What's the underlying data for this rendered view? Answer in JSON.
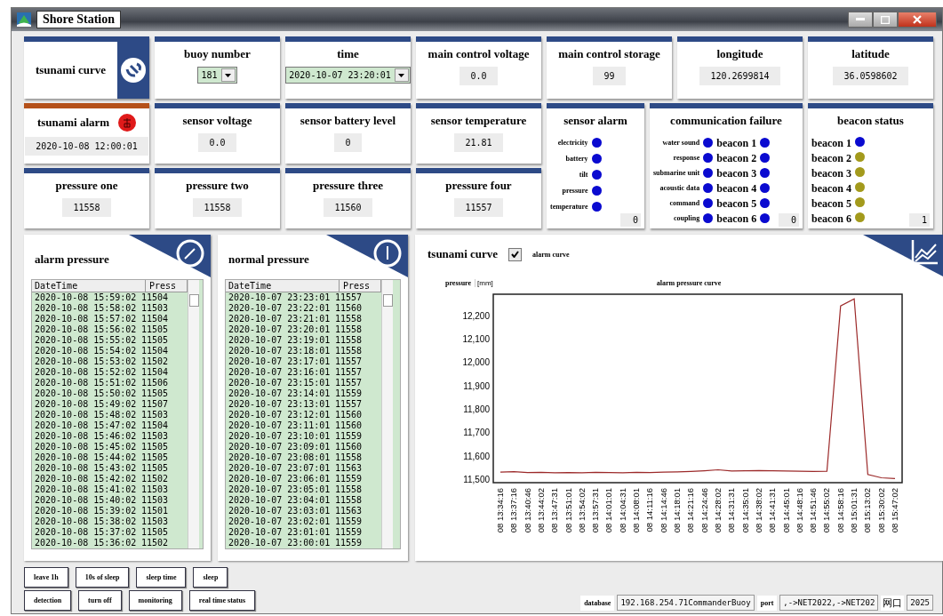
{
  "window": {
    "title": "Shore Station"
  },
  "header_card": {
    "label": "tsunami curve"
  },
  "info_cards": [
    {
      "kind": "select",
      "label": "buoy number",
      "value": "181"
    },
    {
      "kind": "select",
      "label": "time",
      "value": "2020-10-07 23:20:01"
    },
    {
      "kind": "readout",
      "label": "main control voltage",
      "value": "0.0"
    },
    {
      "kind": "readout",
      "label": "main control storage",
      "value": "99"
    },
    {
      "kind": "readout",
      "label": "longitude",
      "value": "120.2699814"
    },
    {
      "kind": "readout",
      "label": "latitude",
      "value": "36.0598602"
    }
  ],
  "tsunami_alarm": {
    "label": "tsunami alarm",
    "active": true,
    "value": "2020-10-08 12:00:01"
  },
  "sensor_cards": [
    {
      "label": "sensor voltage",
      "value": "0.0"
    },
    {
      "label": "sensor battery level",
      "value": "0"
    },
    {
      "label": "sensor temperature",
      "value": "21.81"
    }
  ],
  "pressure_cards": [
    {
      "label": "pressure one",
      "value": "11558"
    },
    {
      "label": "pressure two",
      "value": "11558"
    },
    {
      "label": "pressure three",
      "value": "11560"
    },
    {
      "label": "pressure four",
      "value": "11557"
    }
  ],
  "sensor_alarm": {
    "title": "sensor alarm",
    "items": [
      {
        "label": "electricity",
        "color": "#0a0ad0"
      },
      {
        "label": "battery",
        "color": "#0a0ad0"
      },
      {
        "label": "tilt",
        "color": "#0a0ad0"
      },
      {
        "label": "pressure",
        "color": "#0a0ad0"
      },
      {
        "label": "temperature",
        "color": "#0a0ad0"
      }
    ],
    "count": "0"
  },
  "communication_failure": {
    "title": "communication failure",
    "items": [
      {
        "label": "water sound",
        "color": "#0a0ad0"
      },
      {
        "label": "response",
        "color": "#0a0ad0"
      },
      {
        "label": "submarine unit",
        "color": "#0a0ad0"
      },
      {
        "label": "acoustic data",
        "color": "#0a0ad0"
      },
      {
        "label": "command",
        "color": "#0a0ad0"
      },
      {
        "label": "coupling",
        "color": "#0a0ad0"
      }
    ],
    "beacons": [
      {
        "label": "beacon 1",
        "color": "#0a0ad0"
      },
      {
        "label": "beacon 2",
        "color": "#0a0ad0"
      },
      {
        "label": "beacon 3",
        "color": "#0a0ad0"
      },
      {
        "label": "beacon 4",
        "color": "#0a0ad0"
      },
      {
        "label": "beacon 5",
        "color": "#0a0ad0"
      },
      {
        "label": "beacon 6",
        "color": "#0a0ad0"
      }
    ],
    "count": "0"
  },
  "beacon_status": {
    "title": "beacon status",
    "beacons": [
      {
        "label": "beacon 1",
        "color": "#0a0ad0"
      },
      {
        "label": "beacon 2",
        "color": "#a39a1c"
      },
      {
        "label": "beacon 3",
        "color": "#a39a1c"
      },
      {
        "label": "beacon 4",
        "color": "#a39a1c"
      },
      {
        "label": "beacon 5",
        "color": "#a39a1c"
      },
      {
        "label": "beacon 6",
        "color": "#a39a1c"
      }
    ],
    "count": "1"
  },
  "alarm_pressure": {
    "title": "alarm pressure",
    "columns": [
      "DateTime",
      "Press"
    ],
    "rows": [
      [
        "2020-10-08 15:59:02",
        "11504"
      ],
      [
        "2020-10-08 15:58:02",
        "11503"
      ],
      [
        "2020-10-08 15:57:02",
        "11504"
      ],
      [
        "2020-10-08 15:56:02",
        "11505"
      ],
      [
        "2020-10-08 15:55:02",
        "11505"
      ],
      [
        "2020-10-08 15:54:02",
        "11504"
      ],
      [
        "2020-10-08 15:53:02",
        "11502"
      ],
      [
        "2020-10-08 15:52:02",
        "11504"
      ],
      [
        "2020-10-08 15:51:02",
        "11506"
      ],
      [
        "2020-10-08 15:50:02",
        "11505"
      ],
      [
        "2020-10-08 15:49:02",
        "11507"
      ],
      [
        "2020-10-08 15:48:02",
        "11503"
      ],
      [
        "2020-10-08 15:47:02",
        "11504"
      ],
      [
        "2020-10-08 15:46:02",
        "11503"
      ],
      [
        "2020-10-08 15:45:02",
        "11505"
      ],
      [
        "2020-10-08 15:44:02",
        "11505"
      ],
      [
        "2020-10-08 15:43:02",
        "11505"
      ],
      [
        "2020-10-08 15:42:02",
        "11502"
      ],
      [
        "2020-10-08 15:41:02",
        "11503"
      ],
      [
        "2020-10-08 15:40:02",
        "11503"
      ],
      [
        "2020-10-08 15:39:02",
        "11501"
      ],
      [
        "2020-10-08 15:38:02",
        "11503"
      ],
      [
        "2020-10-08 15:37:02",
        "11505"
      ],
      [
        "2020-10-08 15:36:02",
        "11502"
      ]
    ]
  },
  "normal_pressure": {
    "title": "normal pressure",
    "columns": [
      "DateTime",
      "Press"
    ],
    "rows": [
      [
        "2020-10-07 23:23:01",
        "11557"
      ],
      [
        "2020-10-07 23:22:01",
        "11560"
      ],
      [
        "2020-10-07 23:21:01",
        "11558"
      ],
      [
        "2020-10-07 23:20:01",
        "11558"
      ],
      [
        "2020-10-07 23:19:01",
        "11558"
      ],
      [
        "2020-10-07 23:18:01",
        "11558"
      ],
      [
        "2020-10-07 23:17:01",
        "11557"
      ],
      [
        "2020-10-07 23:16:01",
        "11557"
      ],
      [
        "2020-10-07 23:15:01",
        "11557"
      ],
      [
        "2020-10-07 23:14:01",
        "11559"
      ],
      [
        "2020-10-07 23:13:01",
        "11557"
      ],
      [
        "2020-10-07 23:12:01",
        "11560"
      ],
      [
        "2020-10-07 23:11:01",
        "11560"
      ],
      [
        "2020-10-07 23:10:01",
        "11559"
      ],
      [
        "2020-10-07 23:09:01",
        "11560"
      ],
      [
        "2020-10-07 23:08:01",
        "11558"
      ],
      [
        "2020-10-07 23:07:01",
        "11563"
      ],
      [
        "2020-10-07 23:06:01",
        "11559"
      ],
      [
        "2020-10-07 23:05:01",
        "11558"
      ],
      [
        "2020-10-07 23:04:01",
        "11558"
      ],
      [
        "2020-10-07 23:03:01",
        "11563"
      ],
      [
        "2020-10-07 23:02:01",
        "11559"
      ],
      [
        "2020-10-07 23:01:01",
        "11559"
      ],
      [
        "2020-10-07 23:00:01",
        "11559"
      ]
    ]
  },
  "tsunami_curve": {
    "title": "tsunami curve",
    "checkbox": {
      "label": "alarm curve",
      "checked": true
    },
    "axis_label": "pressure",
    "unit": "[mm]",
    "chart_data": {
      "type": "line",
      "x": [
        "08 13:34:16",
        "08 13:37:16",
        "08 13:40:46",
        "08 13:44:02",
        "08 13:47:31",
        "08 13:51:01",
        "08 13:54:02",
        "08 13:57:31",
        "08 14:01:01",
        "08 14:04:31",
        "08 14:08:01",
        "08 14:11:16",
        "08 14:14:46",
        "08 14:18:01",
        "08 14:21:16",
        "08 14:24:46",
        "08 14:28:02",
        "08 14:31:31",
        "08 14:35:01",
        "08 14:38:02",
        "08 14:41:31",
        "08 14:45:01",
        "08 14:48:16",
        "08 14:51:46",
        "08 14:55:02",
        "08 14:58:16",
        "08 15:01:31",
        "08 15:13:02",
        "08 15:30:02",
        "08 15:47:02"
      ],
      "series": [
        {
          "name": "alarm pressure curve",
          "color": "#9c2a2a",
          "values": [
            11530,
            11532,
            11528,
            11529,
            11527,
            11528,
            11527,
            11529,
            11528,
            11527,
            11529,
            11528,
            11530,
            11531,
            11533,
            11536,
            11540,
            11535,
            11536,
            11537,
            11536,
            11535,
            11534,
            11533,
            11534,
            12240,
            12270,
            11520,
            11506,
            11503
          ]
        }
      ],
      "ylim": [
        11485,
        12290
      ],
      "yticks": [
        {
          "value": 11500,
          "label": "11,500"
        },
        {
          "value": 11600,
          "label": "11,600"
        },
        {
          "value": 11700,
          "label": "11,700"
        },
        {
          "value": 11800,
          "label": "11,800"
        },
        {
          "value": 11900,
          "label": "11,900"
        },
        {
          "value": 12000,
          "label": "12,000"
        },
        {
          "value": 12100,
          "label": "12,100"
        },
        {
          "value": 12200,
          "label": "12,200"
        }
      ]
    }
  },
  "button_rows": [
    [
      {
        "label": "leave 1h"
      },
      {
        "label": "10s of sleep"
      },
      {
        "label": "sleep time"
      },
      {
        "label": "sleep"
      }
    ],
    [
      {
        "label": "detection"
      },
      {
        "label": "turn off"
      },
      {
        "label": "monitoring"
      },
      {
        "label": "real time status"
      }
    ]
  ],
  "status_bar": {
    "fields": [
      {
        "label": "database",
        "value": "192.168.254.71CommanderBuoy"
      },
      {
        "label": "port",
        "value": ",->NET2022,->NET202"
      },
      {
        "label": "网口",
        "value": "2025"
      }
    ]
  }
}
